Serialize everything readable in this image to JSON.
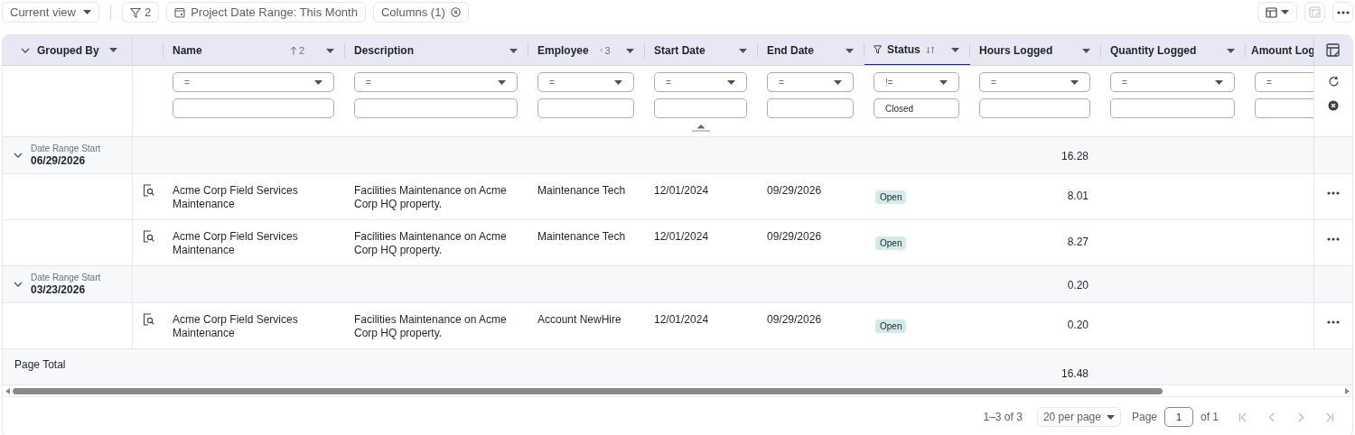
{
  "toolbar": {
    "view": "Current view",
    "filter_count": "2",
    "date_chip": "Project Date Range: This Month",
    "columns_chip": "Columns (1)"
  },
  "group_header": "Grouped By",
  "columns": [
    {
      "label": "Name",
      "sort_rank": "2",
      "filtered": false
    },
    {
      "label": "Description",
      "filtered": false
    },
    {
      "label": "Employee",
      "sort_rank": "3",
      "filtered": false
    },
    {
      "label": "Start Date",
      "filtered": false
    },
    {
      "label": "End Date",
      "filtered": false
    },
    {
      "label": "Status",
      "filtered": true
    },
    {
      "label": "Hours Logged",
      "filtered": false
    },
    {
      "label": "Quantity Logged",
      "filtered": false
    },
    {
      "label": "Amount Log",
      "filtered": false
    }
  ],
  "filters": [
    {
      "operator": "="
    },
    {
      "operator": "="
    },
    {
      "operator": "="
    },
    {
      "operator": "="
    },
    {
      "operator": "="
    },
    {
      "operator": "!=",
      "value": "Closed"
    },
    {
      "operator": "="
    },
    {
      "operator": "="
    },
    {
      "operator": "="
    }
  ],
  "groups": [
    {
      "label": "Date Range Start",
      "value": "06/29/2026",
      "expanded": true,
      "hours_total": "16.28",
      "rows": [
        {
          "name": "Acme Corp Field Services Maintenance",
          "description": "Facilities Maintenance on Acme Corp HQ property.",
          "employee": "Maintenance Tech",
          "start_date": "12/01/2024",
          "end_date": "09/29/2026",
          "status": "Open",
          "hours_logged": "8.01"
        },
        {
          "name": "Acme Corp Field Services Maintenance",
          "description": "Facilities Maintenance on Acme Corp HQ property.",
          "employee": "Maintenance Tech",
          "start_date": "12/01/2024",
          "end_date": "09/29/2026",
          "status": "Open",
          "hours_logged": "8.27"
        }
      ]
    },
    {
      "label": "Date Range Start",
      "value": "03/23/2026",
      "expanded": true,
      "hours_total": "0.20",
      "rows": [
        {
          "name": "Acme Corp Field Services Maintenance",
          "description": "Facilities Maintenance on Acme Corp HQ property.",
          "employee": "Account NewHire",
          "start_date": "12/01/2024",
          "end_date": "09/29/2026",
          "status": "Open",
          "hours_logged": "0.20"
        }
      ]
    }
  ],
  "page_total": {
    "label": "Page Total",
    "hours_total": "16.48"
  },
  "pagination": {
    "range": "1–3 of 3",
    "per_page": "20 per page",
    "page_label": "Page",
    "page": "1",
    "of": "of 1"
  }
}
